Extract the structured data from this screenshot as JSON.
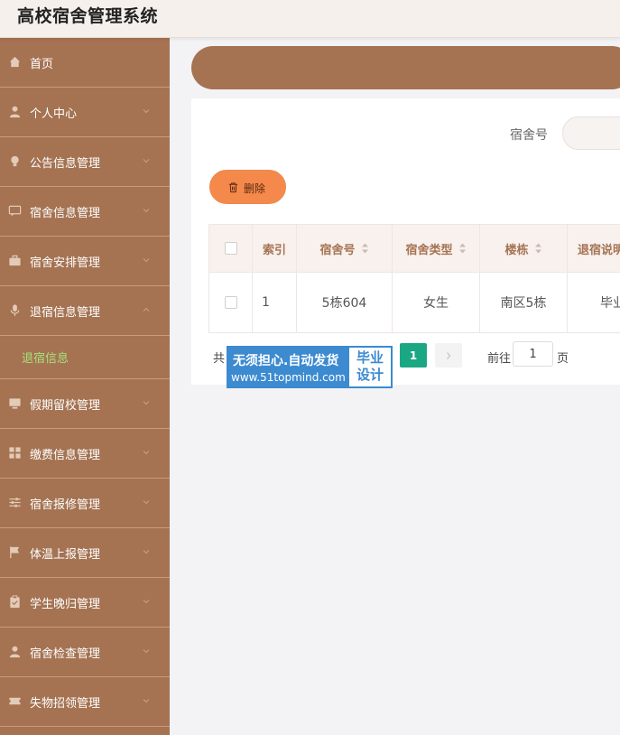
{
  "app": {
    "title": "高校宿舍管理系统"
  },
  "sidebar": {
    "items": [
      {
        "label": "首页",
        "icon": "home-icon",
        "chevron": "none"
      },
      {
        "label": "个人中心",
        "icon": "user-icon",
        "chevron": "down"
      },
      {
        "label": "公告信息管理",
        "icon": "bulb-icon",
        "chevron": "down"
      },
      {
        "label": "宿舍信息管理",
        "icon": "chat-icon",
        "chevron": "down"
      },
      {
        "label": "宿舍安排管理",
        "icon": "briefcase-icon",
        "chevron": "down"
      },
      {
        "label": "退宿信息管理",
        "icon": "microphone-icon",
        "chevron": "up"
      },
      {
        "label": "假期留校管理",
        "icon": "monitor-icon",
        "chevron": "down"
      },
      {
        "label": "缴费信息管理",
        "icon": "grid-icon",
        "chevron": "down"
      },
      {
        "label": "宿舍报修管理",
        "icon": "sliders-icon",
        "chevron": "down"
      },
      {
        "label": "体温上报管理",
        "icon": "flag-icon",
        "chevron": "down"
      },
      {
        "label": "学生晚归管理",
        "icon": "clipboard-icon",
        "chevron": "down"
      },
      {
        "label": "宿舍检查管理",
        "icon": "user-icon",
        "chevron": "down"
      },
      {
        "label": "失物招领管理",
        "icon": "ticket-icon",
        "chevron": "down"
      }
    ],
    "submenu": {
      "label": "退宿信息"
    }
  },
  "search": {
    "label": "宿舍号",
    "value": "",
    "placeholder": ""
  },
  "toolbar": {
    "delete_label": "删除",
    "delete_icon": "trash-icon"
  },
  "table": {
    "columns": [
      {
        "label": "索引",
        "sortable": false
      },
      {
        "label": "宿舍号",
        "sortable": true
      },
      {
        "label": "宿舍类型",
        "sortable": true
      },
      {
        "label": "楼栋",
        "sortable": true
      },
      {
        "label": "退宿说明",
        "sortable": false
      }
    ],
    "rows": [
      {
        "index": "1",
        "room": "5栋604",
        "type": "女生",
        "building": "南区5栋",
        "note": "毕业"
      }
    ]
  },
  "pagination": {
    "total_prefix": "共",
    "current_page": "1",
    "goto_label": "前往",
    "goto_value": "1",
    "page_unit": "页"
  },
  "watermark": {
    "line1": "无须担心.自动发货",
    "line2": "www.51topmind.com",
    "right_line1": "毕业",
    "right_line2": "设计"
  },
  "colors": {
    "sidebar": "#a57352",
    "accent_orange": "#f5894b",
    "active_submenu": "#a6e07a",
    "pagination_active": "#1ba784",
    "watermark_blue": "#3c8ad0"
  }
}
